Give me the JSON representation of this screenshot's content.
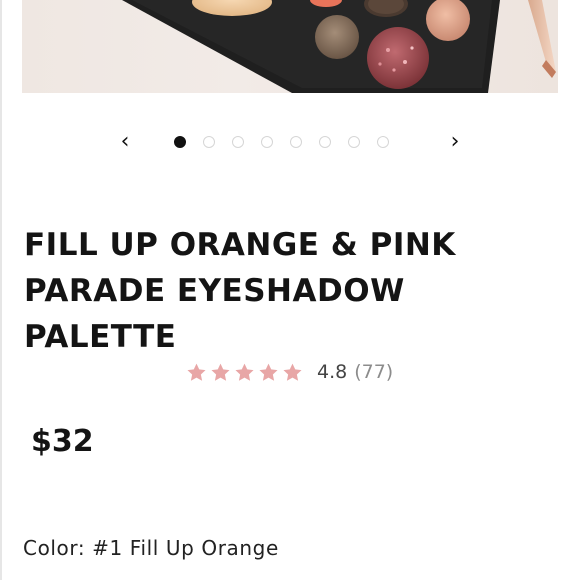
{
  "carousel": {
    "prev_icon": "chevron-left-icon",
    "next_icon": "chevron-right-icon",
    "prev_glyph": "‹",
    "next_glyph": "›",
    "dot_count": 8,
    "active_index": 0
  },
  "product": {
    "title": "FILL UP ORANGE & PINK PARADE EYESHADOW PALETTE",
    "rating": {
      "stars": 5,
      "value": "4.8",
      "count": "(77)",
      "star_color": "#e8a6a6"
    },
    "price": "$32",
    "color_line": "Color: #1 Fill Up Orange"
  }
}
